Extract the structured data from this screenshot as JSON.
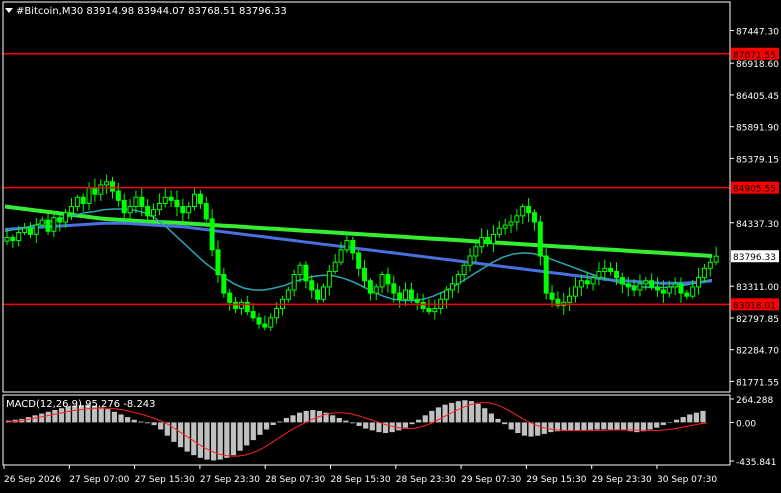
{
  "colors": {
    "background": "#000000",
    "axis": "#ffffff",
    "grid": "#1c1c1c",
    "bull": "#00ff00",
    "bear": "#00ff00",
    "ma_long": "#33ee33",
    "ma_mid": "#4a6fe0",
    "ma_short": "#2aa6b0",
    "level": "#ff0000",
    "hist": "#c0c0c0",
    "signal": "#ff2020"
  },
  "chart_data": {
    "type": "candlestick",
    "title": "#Bitcoin,M30  83914.98 83944.07 83768.51 83796.33",
    "symbol_icon": "triangle-down-icon",
    "price_axis": {
      "range": [
        81600,
        87650
      ],
      "ticks": [
        "87447.30",
        "86918.60",
        "86405.45",
        "85891.90",
        "85379.15",
        "84337.30",
        "83311.00",
        "82797.85",
        "82284.70",
        "81771.55"
      ]
    },
    "time_axis": {
      "labels": [
        "26 Sep 2026",
        "27 Sep 07:00",
        "27 Sep 15:30",
        "27 Sep 23:30",
        "28 Sep 07:30",
        "28 Sep 15:30",
        "28 Sep 23:30",
        "29 Sep 07:30",
        "29 Sep 15:30",
        "29 Sep 23:30",
        "30 Sep 07:30"
      ]
    },
    "levels": [
      {
        "price": 87071.55,
        "label": "87071.55"
      },
      {
        "price": 84905.55,
        "label": "84905.55"
      },
      {
        "price": 83018.01,
        "label": "83018.01"
      }
    ],
    "current_price": {
      "price": 83796.33,
      "label": "83796.33"
    },
    "close_series": [
      84100,
      84050,
      84180,
      84250,
      84150,
      84300,
      84380,
      84200,
      84420,
      84350,
      84500,
      84600,
      84750,
      84650,
      84900,
      84800,
      84950,
      85000,
      84850,
      84700,
      84500,
      84600,
      84750,
      84600,
      84450,
      84550,
      84650,
      84750,
      84700,
      84600,
      84500,
      84600,
      84800,
      84650,
      84400,
      83900,
      83500,
      83200,
      83050,
      82950,
      83050,
      82900,
      82800,
      82700,
      82650,
      82800,
      82950,
      83100,
      83250,
      83500,
      83650,
      83400,
      83250,
      83100,
      83300,
      83550,
      83700,
      83900,
      84050,
      83850,
      83600,
      83400,
      83200,
      83300,
      83500,
      83350,
      83200,
      83100,
      83250,
      83100,
      83050,
      82950,
      82900,
      82950,
      83100,
      83250,
      83350,
      83500,
      83650,
      83800,
      83950,
      84100,
      84000,
      84150,
      84250,
      84300,
      84350,
      84450,
      84600,
      84500,
      84350,
      83800,
      83200,
      83100,
      83000,
      83050,
      83150,
      83300,
      83400,
      83350,
      83450,
      83550,
      83600,
      83550,
      83450,
      83350,
      83300,
      83250,
      83350,
      83400,
      83300,
      83250,
      83200,
      83300,
      83350,
      83200,
      83150,
      83300,
      83450,
      83600,
      83700,
      83796
    ],
    "moving_averages": [
      {
        "name": "ma_long",
        "values": [
          84600,
          84580,
          84560,
          84540,
          84520,
          84500,
          84480,
          84460,
          84440,
          84420,
          84400,
          84390,
          84380,
          84370,
          84360,
          84350,
          84345,
          84340,
          84330,
          84320,
          84310,
          84300,
          84290,
          84280,
          84270,
          84260,
          84250,
          84240,
          84230,
          84220,
          84210,
          84200,
          84190,
          84180,
          84170,
          84160,
          84150,
          84140,
          84130,
          84120,
          84110,
          84100,
          84090,
          84080,
          84070,
          84060,
          84050,
          84040,
          84030,
          84020,
          84010,
          84000,
          83990,
          83980,
          83970,
          83960,
          83950,
          83940,
          83930,
          83920,
          83910,
          83900,
          83890,
          83880,
          83870,
          83860,
          83850,
          83840,
          83830,
          83820,
          83810,
          83800
        ]
      },
      {
        "name": "ma_mid",
        "values": [
          84230,
          84240,
          84250,
          84260,
          84270,
          84280,
          84290,
          84300,
          84310,
          84320,
          84330,
          84330,
          84330,
          84320,
          84310,
          84300,
          84290,
          84280,
          84270,
          84250,
          84230,
          84210,
          84190,
          84170,
          84150,
          84130,
          84110,
          84090,
          84070,
          84050,
          84030,
          84010,
          83990,
          83970,
          83950,
          83930,
          83910,
          83890,
          83870,
          83850,
          83830,
          83810,
          83790,
          83770,
          83750,
          83730,
          83710,
          83690,
          83670,
          83650,
          83630,
          83610,
          83590,
          83570,
          83550,
          83530,
          83510,
          83490,
          83470,
          83450,
          83430,
          83410,
          83400,
          83390,
          83380,
          83370,
          83360,
          83360,
          83360,
          83370,
          83380,
          83400
        ]
      },
      {
        "name": "ma_short",
        "values": [
          84200,
          84230,
          84260,
          84300,
          84340,
          84380,
          84420,
          84460,
          84500,
          84520,
          84550,
          84560,
          84560,
          84540,
          84500,
          84420,
          84300,
          84150,
          84000,
          83850,
          83700,
          83580,
          83450,
          83350,
          83280,
          83250,
          83250,
          83280,
          83320,
          83380,
          83430,
          83470,
          83490,
          83480,
          83440,
          83380,
          83300,
          83220,
          83150,
          83100,
          83080,
          83080,
          83100,
          83150,
          83220,
          83300,
          83400,
          83500,
          83600,
          83700,
          83780,
          83830,
          83850,
          83840,
          83800,
          83740,
          83680,
          83620,
          83560,
          83500,
          83450,
          83400,
          83350,
          83320,
          83300,
          83290,
          83290,
          83300,
          83320,
          83350,
          83380,
          83420
        ]
      }
    ],
    "indicator": {
      "label": "MACD(12,26,9) 95.276 -8.243",
      "range": [
        -435.841,
        264.288
      ],
      "ticks": [
        "264.288",
        "0.00",
        "-435.841"
      ],
      "histogram": [
        20,
        30,
        40,
        60,
        80,
        100,
        120,
        140,
        160,
        180,
        190,
        195,
        200,
        190,
        170,
        150,
        120,
        90,
        60,
        30,
        10,
        -10,
        -30,
        -80,
        -150,
        -220,
        -280,
        -330,
        -370,
        -400,
        -420,
        -430,
        -420,
        -400,
        -370,
        -320,
        -260,
        -200,
        -140,
        -80,
        -30,
        10,
        50,
        80,
        110,
        130,
        140,
        130,
        110,
        80,
        50,
        20,
        -10,
        -40,
        -70,
        -90,
        -110,
        -120,
        -110,
        -90,
        -60,
        -20,
        30,
        80,
        130,
        170,
        200,
        220,
        240,
        250,
        240,
        210,
        160,
        100,
        40,
        -20,
        -80,
        -120,
        -150,
        -160,
        -150,
        -130,
        -110,
        -100,
        -95,
        -90,
        -88,
        -86,
        -84,
        -80,
        -78,
        -80,
        -85,
        -90,
        -100,
        -110,
        -100,
        -80,
        -60,
        -30,
        0,
        30,
        60,
        90,
        110,
        130
      ],
      "signal": [
        0,
        10,
        20,
        30,
        45,
        60,
        75,
        90,
        105,
        120,
        135,
        145,
        155,
        160,
        162,
        160,
        155,
        145,
        130,
        110,
        90,
        65,
        40,
        10,
        -30,
        -80,
        -130,
        -180,
        -230,
        -280,
        -320,
        -350,
        -370,
        -380,
        -380,
        -370,
        -350,
        -320,
        -280,
        -230,
        -180,
        -130,
        -80,
        -40,
        0,
        35,
        65,
        90,
        105,
        110,
        105,
        90,
        70,
        45,
        20,
        -5,
        -30,
        -50,
        -65,
        -70,
        -65,
        -50,
        -25,
        10,
        50,
        90,
        130,
        165,
        195,
        215,
        225,
        220,
        200,
        170,
        130,
        85,
        40,
        0,
        -35,
        -60,
        -75,
        -85,
        -90,
        -92,
        -93,
        -93,
        -92,
        -90,
        -88,
        -86,
        -85,
        -85,
        -86,
        -88,
        -90,
        -92,
        -90,
        -85,
        -75,
        -60,
        -45,
        -30,
        -15,
        -8
      ]
    }
  }
}
